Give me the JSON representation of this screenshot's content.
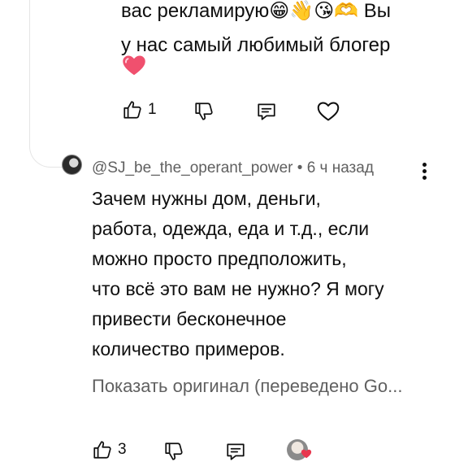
{
  "previous_comment": {
    "lines": [
      "вас рекламирую",
      "у нас самый любимый блогер"
    ],
    "emoji_tail": "😁👋😘🫶",
    "tail_text": " Вы",
    "like_count": "1"
  },
  "comment": {
    "author": "@SJ_be_the_operant_power",
    "separator": "•",
    "time": "6 ч назад",
    "lines": [
      "Зачем нужны дом, деньги,",
      "работа, одежда, еда и т.д., если",
      "можно просто предположить,",
      "что всё это вам не нужно? Я могу",
      "привести бесконечное",
      "количество примеров."
    ],
    "show_original": "Показать оригинал (переведено Go...",
    "like_count": "3"
  },
  "icons": [
    "thumbs-up-icon",
    "thumbs-down-icon",
    "reply-icon",
    "heart-icon",
    "more-vert-icon",
    "heart-emoji"
  ],
  "colors": {
    "text": "#0f0f0f",
    "secondary": "#606060",
    "heart": "#e8384f"
  }
}
